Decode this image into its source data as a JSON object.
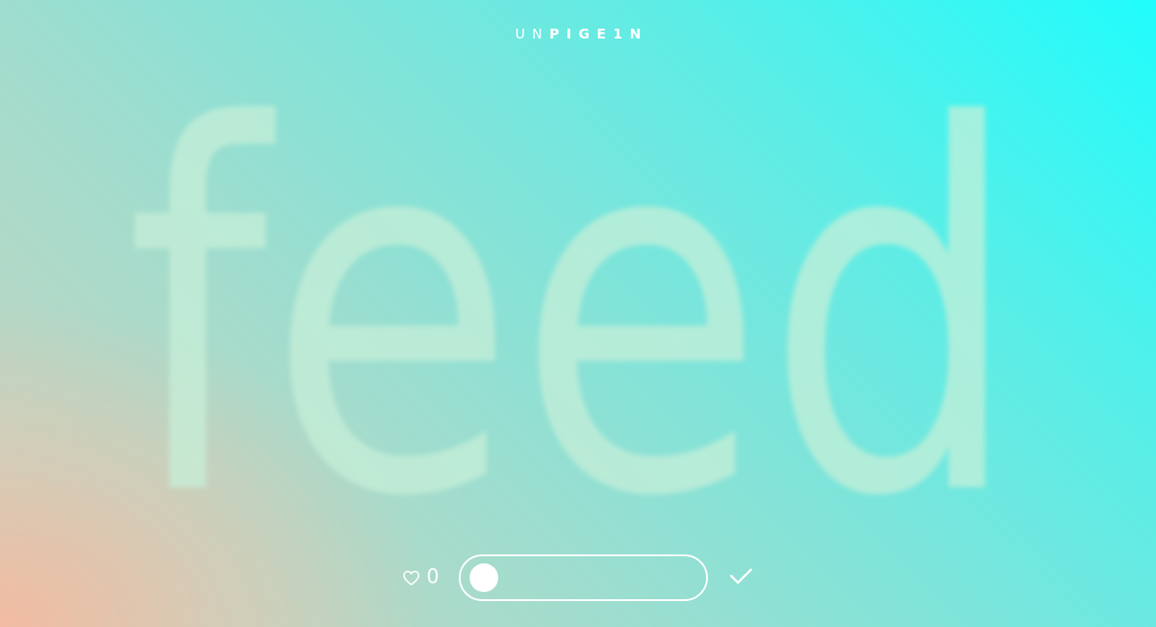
{
  "brand": {
    "prefix": "UN",
    "suffix": "PIGE1N"
  },
  "hero": {
    "word": "feed"
  },
  "controls": {
    "like_icon": "heart-outline-icon",
    "like_count": "0",
    "slider_state": "off",
    "confirm_icon": "checkmark-icon"
  },
  "colors": {
    "accent": "#ffffff",
    "gradient_top_right": "#1ffcfc",
    "gradient_bottom_left": "#f4baa0",
    "hero_text": "#c8f0d8"
  }
}
